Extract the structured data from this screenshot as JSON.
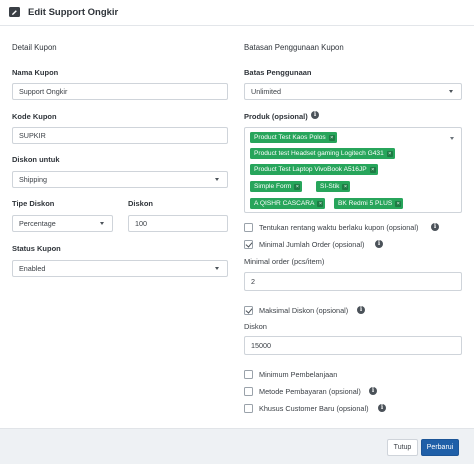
{
  "header": {
    "title": "Edit Support Ongkir",
    "icon": "edit-icon"
  },
  "left": {
    "section_title": "Detail Kupon",
    "nama_kupon": {
      "label": "Nama Kupon",
      "value": "Support Ongkir"
    },
    "kode_kupon": {
      "label": "Kode Kupon",
      "value": "SUPKIR"
    },
    "diskon_untuk": {
      "label": "Diskon untuk",
      "value": "Shipping"
    },
    "tipe_diskon": {
      "label": "Tipe Diskon",
      "value": "Percentage"
    },
    "diskon": {
      "label": "Diskon",
      "value": "100"
    },
    "status_kupon": {
      "label": "Status Kupon",
      "value": "Enabled"
    }
  },
  "right": {
    "section_title": "Batasan Penggunaan Kupon",
    "batas_penggunaan": {
      "label": "Batas Penggunaan",
      "value": "Unlimited"
    },
    "produk": {
      "label": "Produk (opsional)",
      "tags": [
        "Product Test Kaos Polos",
        "Product test Headset gaming Logitech G431",
        "Product Test Laptop VivoBook A516JP",
        "Simple Form",
        "SI-Stik",
        "A QISHR CASCARA",
        "BK Redmi 5 PLUS"
      ]
    },
    "rentang_waktu": {
      "label": "Tentukan rentang waktu berlaku kupon (opsional)",
      "checked": false
    },
    "minimal_jumlah": {
      "label": "Minimal Jumlah Order (opsional)",
      "checked": true
    },
    "minimal_order": {
      "label": "Minimal order (pcs/item)",
      "value": "2"
    },
    "maksimal_diskon": {
      "label": "Maksimal Diskon (opsional)",
      "checked": true
    },
    "diskon_max": {
      "label": "Diskon",
      "value": "15000"
    },
    "minimum_pembelanjaan": {
      "label": "Minimum Pembelanjaan",
      "checked": false
    },
    "metode_pembayaran": {
      "label": "Metode Pembayaran (opsional)",
      "checked": false
    },
    "khusus_customer": {
      "label": "Khusus Customer Baru (opsional)",
      "checked": false
    }
  },
  "footer": {
    "close_label": "Tutup",
    "save_label": "Perbarui"
  },
  "colors": {
    "tag": "#27a55b",
    "primary": "#1f5fa8",
    "footer_bg": "#eef1f4"
  }
}
